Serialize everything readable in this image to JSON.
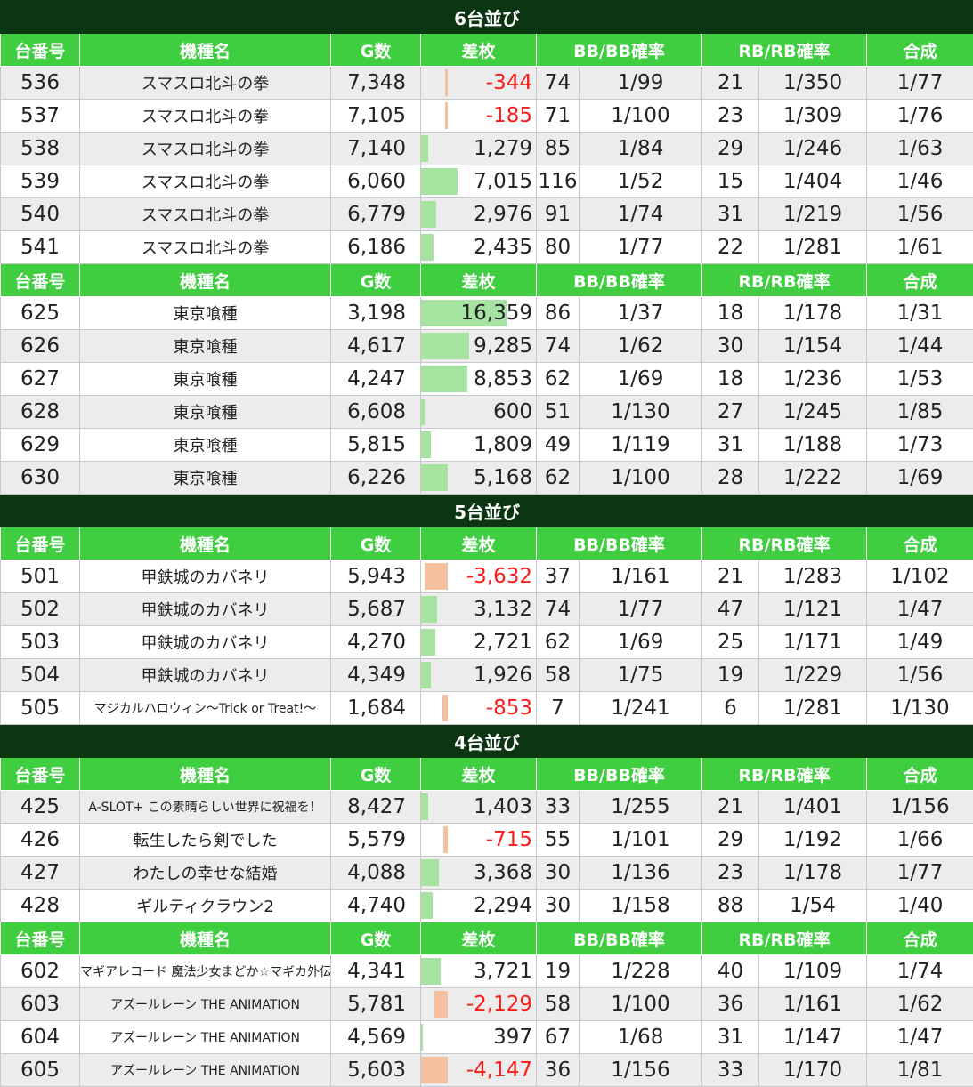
{
  "headers": {
    "id": "台番号",
    "model": "機種名",
    "games": "G数",
    "diff": "差枚",
    "bb": "BB/BB確率",
    "rb": "RB/RB確率",
    "total": "合成"
  },
  "sections": [
    {
      "title": "6台並び",
      "groups": [
        {
          "rows": [
            {
              "id": "536",
              "model": "スマスロ北斗の拳",
              "games": "7,348",
              "diff": "-344",
              "diff_value": -344,
              "bb": "74",
              "bb_rate": "1/99",
              "rb": "21",
              "rb_rate": "1/350",
              "total": "1/77"
            },
            {
              "id": "537",
              "model": "スマスロ北斗の拳",
              "games": "7,105",
              "diff": "-185",
              "diff_value": -185,
              "bb": "71",
              "bb_rate": "1/100",
              "rb": "23",
              "rb_rate": "1/309",
              "total": "1/76"
            },
            {
              "id": "538",
              "model": "スマスロ北斗の拳",
              "games": "7,140",
              "diff": "1,279",
              "diff_value": 1279,
              "bb": "85",
              "bb_rate": "1/84",
              "rb": "29",
              "rb_rate": "1/246",
              "total": "1/63"
            },
            {
              "id": "539",
              "model": "スマスロ北斗の拳",
              "games": "6,060",
              "diff": "7,015",
              "diff_value": 7015,
              "bb": "116",
              "bb_rate": "1/52",
              "rb": "15",
              "rb_rate": "1/404",
              "total": "1/46"
            },
            {
              "id": "540",
              "model": "スマスロ北斗の拳",
              "games": "6,779",
              "diff": "2,976",
              "diff_value": 2976,
              "bb": "91",
              "bb_rate": "1/74",
              "rb": "31",
              "rb_rate": "1/219",
              "total": "1/56"
            },
            {
              "id": "541",
              "model": "スマスロ北斗の拳",
              "games": "6,186",
              "diff": "2,435",
              "diff_value": 2435,
              "bb": "80",
              "bb_rate": "1/77",
              "rb": "22",
              "rb_rate": "1/281",
              "total": "1/61"
            }
          ]
        },
        {
          "rows": [
            {
              "id": "625",
              "model": "東京喰種",
              "games": "3,198",
              "diff": "16,359",
              "diff_value": 16359,
              "bb": "86",
              "bb_rate": "1/37",
              "rb": "18",
              "rb_rate": "1/178",
              "total": "1/31"
            },
            {
              "id": "626",
              "model": "東京喰種",
              "games": "4,617",
              "diff": "9,285",
              "diff_value": 9285,
              "bb": "74",
              "bb_rate": "1/62",
              "rb": "30",
              "rb_rate": "1/154",
              "total": "1/44"
            },
            {
              "id": "627",
              "model": "東京喰種",
              "games": "4,247",
              "diff": "8,853",
              "diff_value": 8853,
              "bb": "62",
              "bb_rate": "1/69",
              "rb": "18",
              "rb_rate": "1/236",
              "total": "1/53"
            },
            {
              "id": "628",
              "model": "東京喰種",
              "games": "6,608",
              "diff": "600",
              "diff_value": 600,
              "bb": "51",
              "bb_rate": "1/130",
              "rb": "27",
              "rb_rate": "1/245",
              "total": "1/85"
            },
            {
              "id": "629",
              "model": "東京喰種",
              "games": "5,815",
              "diff": "1,809",
              "diff_value": 1809,
              "bb": "49",
              "bb_rate": "1/119",
              "rb": "31",
              "rb_rate": "1/188",
              "total": "1/73"
            },
            {
              "id": "630",
              "model": "東京喰種",
              "games": "6,226",
              "diff": "5,168",
              "diff_value": 5168,
              "bb": "62",
              "bb_rate": "1/100",
              "rb": "28",
              "rb_rate": "1/222",
              "total": "1/69"
            }
          ]
        }
      ]
    },
    {
      "title": "5台並び",
      "groups": [
        {
          "rows": [
            {
              "id": "501",
              "model": "甲鉄城のカバネリ",
              "games": "5,943",
              "diff": "-3,632",
              "diff_value": -3632,
              "bb": "37",
              "bb_rate": "1/161",
              "rb": "21",
              "rb_rate": "1/283",
              "total": "1/102"
            },
            {
              "id": "502",
              "model": "甲鉄城のカバネリ",
              "games": "5,687",
              "diff": "3,132",
              "diff_value": 3132,
              "bb": "74",
              "bb_rate": "1/77",
              "rb": "47",
              "rb_rate": "1/121",
              "total": "1/47"
            },
            {
              "id": "503",
              "model": "甲鉄城のカバネリ",
              "games": "4,270",
              "diff": "2,721",
              "diff_value": 2721,
              "bb": "62",
              "bb_rate": "1/69",
              "rb": "25",
              "rb_rate": "1/171",
              "total": "1/49"
            },
            {
              "id": "504",
              "model": "甲鉄城のカバネリ",
              "games": "4,349",
              "diff": "1,926",
              "diff_value": 1926,
              "bb": "58",
              "bb_rate": "1/75",
              "rb": "19",
              "rb_rate": "1/229",
              "total": "1/56"
            },
            {
              "id": "505",
              "model": "マジカルハロウィン〜Trick or Treat!〜",
              "games": "1,684",
              "diff": "-853",
              "diff_value": -853,
              "bb": "7",
              "bb_rate": "1/241",
              "rb": "6",
              "rb_rate": "1/281",
              "total": "1/130",
              "small": true
            }
          ]
        }
      ]
    },
    {
      "title": "4台並び",
      "groups": [
        {
          "rows": [
            {
              "id": "425",
              "model": "A-SLOT+ この素晴らしい世界に祝福を！",
              "games": "8,427",
              "diff": "1,403",
              "diff_value": 1403,
              "bb": "33",
              "bb_rate": "1/255",
              "rb": "21",
              "rb_rate": "1/401",
              "total": "1/156",
              "small": true
            },
            {
              "id": "426",
              "model": "転生したら剣でした",
              "games": "5,579",
              "diff": "-715",
              "diff_value": -715,
              "bb": "55",
              "bb_rate": "1/101",
              "rb": "29",
              "rb_rate": "1/192",
              "total": "1/66"
            },
            {
              "id": "427",
              "model": "わたしの幸せな結婚",
              "games": "4,088",
              "diff": "3,368",
              "diff_value": 3368,
              "bb": "30",
              "bb_rate": "1/136",
              "rb": "23",
              "rb_rate": "1/178",
              "total": "1/77"
            },
            {
              "id": "428",
              "model": "ギルティクラウン2",
              "games": "4,740",
              "diff": "2,294",
              "diff_value": 2294,
              "bb": "30",
              "bb_rate": "1/158",
              "rb": "88",
              "rb_rate": "1/54",
              "total": "1/40"
            }
          ]
        },
        {
          "rows": [
            {
              "id": "602",
              "model": "マギアレコード 魔法少女まどか☆マギカ外伝",
              "games": "4,341",
              "diff": "3,721",
              "diff_value": 3721,
              "bb": "19",
              "bb_rate": "1/228",
              "rb": "40",
              "rb_rate": "1/109",
              "total": "1/74",
              "small": true
            },
            {
              "id": "603",
              "model": "アズールレーン THE ANIMATION",
              "games": "5,781",
              "diff": "-2,129",
              "diff_value": -2129,
              "bb": "58",
              "bb_rate": "1/100",
              "rb": "36",
              "rb_rate": "1/161",
              "total": "1/62",
              "small": true
            },
            {
              "id": "604",
              "model": "アズールレーン THE ANIMATION",
              "games": "4,569",
              "diff": "397",
              "diff_value": 397,
              "bb": "67",
              "bb_rate": "1/68",
              "rb": "31",
              "rb_rate": "1/147",
              "total": "1/47",
              "small": true
            },
            {
              "id": "605",
              "model": "アズールレーン THE ANIMATION",
              "games": "5,603",
              "diff": "-4,147",
              "diff_value": -4147,
              "bb": "36",
              "bb_rate": "1/156",
              "rb": "33",
              "rb_rate": "1/170",
              "total": "1/81",
              "small": true
            }
          ]
        }
      ]
    }
  ],
  "colors": {
    "section_bg": "#0c3511",
    "header_bg": "#3fce3f",
    "positive_bar": "#a6e3a1",
    "negative_bar": "#f5c09e",
    "negative_text": "#ff1a1a"
  }
}
